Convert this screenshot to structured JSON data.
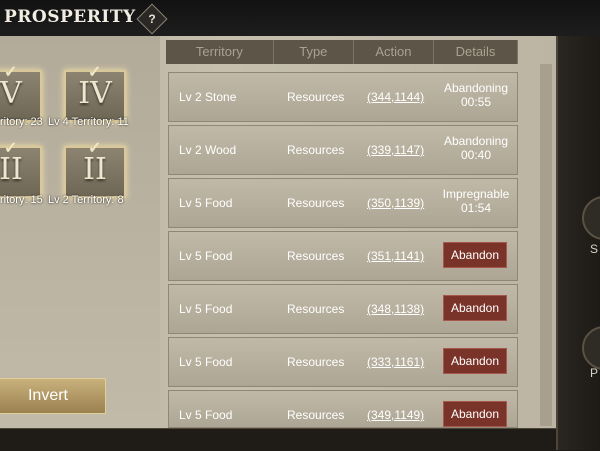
{
  "header": {
    "title": "PROSPERITY",
    "help_label": "?"
  },
  "territories": [
    {
      "numeral": "V",
      "label": "ritory: 23"
    },
    {
      "numeral": "IV",
      "label": "Lv 4 Territory: 11"
    },
    {
      "numeral": "II",
      "label": "ritory: 15"
    },
    {
      "numeral": "II",
      "label": "Lv 2 Territory: 8"
    }
  ],
  "invert_label": "Invert",
  "table": {
    "headers": [
      "Territory",
      "Type",
      "Action",
      "Details"
    ],
    "rows": [
      {
        "name": "Lv 2 Stone",
        "type": "Resources",
        "coord": "(344,1144)",
        "status_line1": "Abandoning",
        "status_line2": "00:55",
        "status_color": "red"
      },
      {
        "name": "Lv 2 Wood",
        "type": "Resources",
        "coord": "(339,1147)",
        "status_line1": "Abandoning",
        "status_line2": "00:40",
        "status_color": "red"
      },
      {
        "name": "Lv 5 Food",
        "type": "Resources",
        "coord": "(350,1139)",
        "status_line1": "Impregnable",
        "status_line2": "01:54",
        "status_color": "white"
      },
      {
        "name": "Lv 5 Food",
        "type": "Resources",
        "coord": "(351,1141)",
        "button": "Abandon"
      },
      {
        "name": "Lv 5 Food",
        "type": "Resources",
        "coord": "(348,1138)",
        "button": "Abandon"
      },
      {
        "name": "Lv 5 Food",
        "type": "Resources",
        "coord": "(333,1161)",
        "button": "Abandon"
      },
      {
        "name": "Lv 5 Food",
        "type": "Resources",
        "coord": "(349,1149)",
        "button": "Abandon"
      }
    ]
  },
  "right_panel": {
    "letter_1": "S",
    "letter_2": "P"
  }
}
